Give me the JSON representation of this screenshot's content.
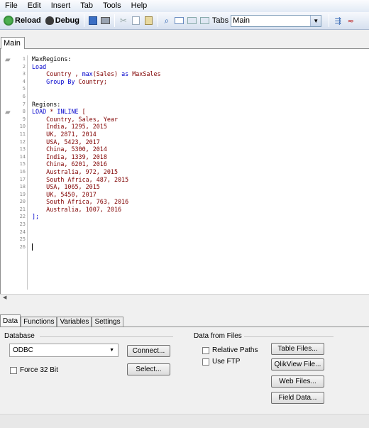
{
  "menu": [
    "File",
    "Edit",
    "Insert",
    "Tab",
    "Tools",
    "Help"
  ],
  "toolbar": {
    "reload_label": "Reload",
    "debug_label": "Debug",
    "tabs_label": "Tabs",
    "tab_select_value": "Main",
    "icons": [
      "save-icon",
      "print-icon",
      "cut-icon",
      "copy-icon",
      "paste-icon",
      "find-icon",
      "new-tab-icon",
      "promote-tab-icon",
      "demote-tab-icon",
      "tab-dropdown-icon",
      "table-viewer-icon",
      "syntax-check-icon"
    ]
  },
  "script_tab": "Main",
  "editor": {
    "line_numbers": [
      "1",
      "2",
      "3",
      "4",
      "5",
      "6",
      "7",
      "8",
      "9",
      "10",
      "11",
      "12",
      "13",
      "14",
      "15",
      "16",
      "17",
      "18",
      "19",
      "20",
      "21",
      "22",
      "23",
      "24",
      "25",
      "26"
    ],
    "lines": [
      "MaxRegions:",
      "Load",
      "    Country , max(Sales) as MaxSales",
      "    Group By Country;",
      "",
      "",
      "Regions:",
      "LOAD * INLINE [",
      "    Country, Sales, Year",
      "    India, 1295, 2015",
      "    UK, 2871, 2014",
      "    USA, 5423, 2017",
      "    China, 5300, 2014",
      "    India, 1339, 2018",
      "    China, 6201, 2016",
      "    Australia, 972, 2015",
      "    South Africa, 487, 2015",
      "    USA, 1065, 2015",
      "    UK, 5450, 2017",
      "    South Africa, 763, 2016",
      "    Australia, 1007, 2016",
      "];",
      "",
      "",
      "",
      ""
    ]
  },
  "bottom_tabs": [
    "Data",
    "Functions",
    "Variables",
    "Settings"
  ],
  "database": {
    "group_label": "Database",
    "selected": "ODBC",
    "force32_label": "Force 32 Bit",
    "connect_label": "Connect...",
    "select_label": "Select..."
  },
  "files": {
    "group_label": "Data from Files",
    "relative_paths_label": "Relative Paths",
    "use_ftp_label": "Use FTP",
    "table_files_label": "Table Files...",
    "qlikview_file_label": "QlikView File...",
    "web_files_label": "Web Files...",
    "field_data_label": "Field Data..."
  }
}
